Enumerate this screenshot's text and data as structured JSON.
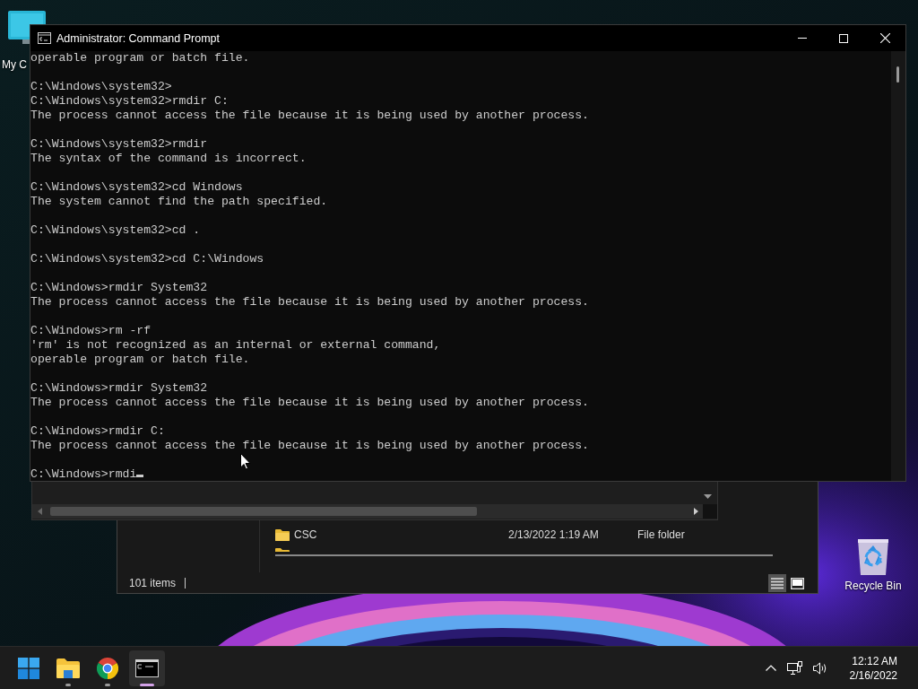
{
  "desktop": {
    "icons": [
      {
        "kind": "computer",
        "label": "My C"
      },
      {
        "kind": "recycle-bin",
        "label": "Recycle Bin"
      }
    ]
  },
  "browser_window": {
    "kind": "picture-behind"
  },
  "explorer_window": {
    "rows": [
      {
        "name": "CSC",
        "date_modified": "2/13/2022 1:19 AM",
        "type": "File folder"
      }
    ],
    "status": "101 items"
  },
  "console_window": {
    "title": "Administrator: Command Prompt",
    "blocks": [
      [
        "operable program or batch file."
      ],
      [
        "C:\\Windows\\system32>",
        "C:\\Windows\\system32>rmdir C:",
        "The process cannot access the file because it is being used by another process."
      ],
      [
        "C:\\Windows\\system32>rmdir",
        "The syntax of the command is incorrect."
      ],
      [
        "C:\\Windows\\system32>cd Windows",
        "The system cannot find the path specified."
      ],
      [
        "C:\\Windows\\system32>cd ."
      ],
      [
        "C:\\Windows\\system32>cd C:\\Windows"
      ],
      [
        "C:\\Windows>rmdir System32",
        "The process cannot access the file because it is being used by another process."
      ],
      [
        "C:\\Windows>rm -rf",
        "'rm' is not recognized as an internal or external command,",
        "operable program or batch file."
      ],
      [
        "C:\\Windows>rmdir System32",
        "The process cannot access the file because it is being used by another process."
      ],
      [
        "C:\\Windows>rmdir C:",
        "The process cannot access the file because it is being used by another process."
      ],
      [
        "C:\\Windows>rmdi"
      ]
    ]
  },
  "taskbar": {
    "apps": [
      {
        "kind": "explorer",
        "running": true,
        "selected": false
      },
      {
        "kind": "chrome",
        "running": true,
        "selected": false
      },
      {
        "kind": "terminal",
        "running": true,
        "selected": true
      }
    ],
    "clock": {
      "time": "12:12 AM",
      "date": "2/16/2022"
    }
  }
}
